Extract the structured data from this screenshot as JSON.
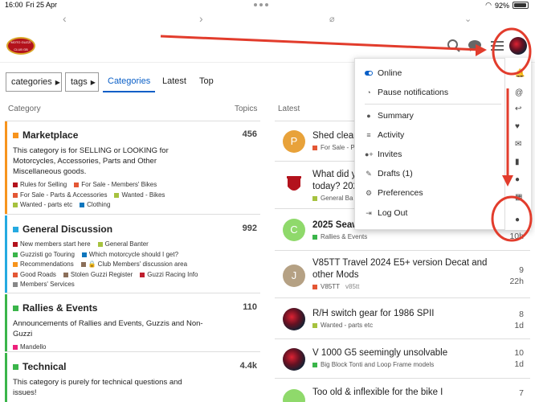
{
  "status_bar": {
    "time": "16:00",
    "date": "Fri 25 Apr",
    "battery": "92%"
  },
  "header": {
    "logo_text": "MOTO GUZZI CLUB GB"
  },
  "nav": {
    "categories_dropdown": "categories",
    "tags_dropdown": "tags",
    "tabs": [
      {
        "label": "Categories",
        "active": true
      },
      {
        "label": "Latest",
        "active": false
      },
      {
        "label": "Top",
        "active": false
      }
    ]
  },
  "columns": {
    "category": "Category",
    "topics": "Topics",
    "latest": "Latest"
  },
  "categories": [
    {
      "name": "Marketplace",
      "color": "#f7941d",
      "count": "456",
      "description": "This category is for SELLING or LOOKING for Motorcycles, Accessories, Parts and Other Miscellaneous goods.",
      "subcategories": [
        {
          "name": "Rules for Selling",
          "color": "#b3121c"
        },
        {
          "name": "For Sale - Members' Bikes",
          "color": "#e45735"
        },
        {
          "name": "For Sale - Parts & Accessories",
          "color": "#e45735"
        },
        {
          "name": "Wanted - Bikes",
          "color": "#a6c23f"
        },
        {
          "name": "Wanted - parts etc",
          "color": "#a6c23f"
        },
        {
          "name": "Clothing",
          "color": "#0e76bd"
        }
      ]
    },
    {
      "name": "General Discussion",
      "color": "#25aae1",
      "count": "992",
      "description": "",
      "subcategories": [
        {
          "name": "New members start here",
          "color": "#b3121c"
        },
        {
          "name": "General Banter",
          "color": "#a6c23f"
        },
        {
          "name": "Guzzisti go Touring",
          "color": "#3ab54a"
        },
        {
          "name": "Which motorcycle should I get?",
          "color": "#0e76bd"
        },
        {
          "name": "Recommendations",
          "color": "#f7941d"
        },
        {
          "name": "Club Members' discussion area",
          "color": "#8b6f5a"
        },
        {
          "name": "Good Roads",
          "color": "#e45735"
        },
        {
          "name": "Stolen Guzzi Register",
          "color": "#8b6f5a"
        },
        {
          "name": "Guzzi Racing Info",
          "color": "#bf1e2e"
        },
        {
          "name": "Members' Services",
          "color": "#888888"
        }
      ]
    },
    {
      "name": "Rallies & Events",
      "color": "#3ab54a",
      "count": "110",
      "description": "Announcements of Rallies and Events, Guzzis and Non-Guzzi",
      "subcategories": [
        {
          "name": "Mandello",
          "color": "#ed207b"
        }
      ]
    },
    {
      "name": "Technical",
      "color": "#3ab54a",
      "count": "4.4k",
      "description": "This category is purely for technical questions and issues!",
      "subcategories": []
    }
  ],
  "latest_topics": [
    {
      "avatar": "P",
      "avatar_color": "#e8a23a",
      "title": "Shed clear",
      "category": "For Sale - P",
      "category_color": "#e45735",
      "replies": "",
      "age": ""
    },
    {
      "avatar": "",
      "avatar_color": "#ffffff",
      "title": "What did y today? 202",
      "category": "General Ba",
      "category_color": "#a6c23f",
      "replies": "",
      "age": ""
    },
    {
      "avatar": "C",
      "avatar_color": "#8fd96b",
      "title": "2025 Seaw",
      "category": "Rallies & Events",
      "category_color": "#3ab54a",
      "replies": "",
      "age": "10h"
    },
    {
      "avatar": "J",
      "avatar_color": "#b5a184",
      "title": "V85TT Travel 2024 E5+ version Decat and other Mods",
      "category": "V85TT",
      "category_color": "#e45735",
      "tag": "v85tt",
      "replies": "9",
      "age": "22h"
    },
    {
      "avatar": "",
      "avatar_color": "#5a2a3a",
      "title": "R/H switch gear for 1986 SPII",
      "category": "Wanted - parts etc",
      "category_color": "#a6c23f",
      "replies": "8",
      "age": "1d"
    },
    {
      "avatar": "",
      "avatar_color": "#5a2a3a",
      "title": "V 1000 G5 seemingly unsolvable",
      "category": "Big Block Tonti and Loop Frame models",
      "category_color": "#3ab54a",
      "replies": "10",
      "age": "1d"
    },
    {
      "avatar": "",
      "avatar_color": "#8fd96b",
      "title": "Too old & inflexible for the bike I",
      "category": "",
      "category_color": "#3ab54a",
      "replies": "7",
      "age": ""
    }
  ],
  "user_menu": {
    "items": [
      {
        "label": "Online",
        "icon": "toggle-icon"
      },
      {
        "label": "Pause notifications",
        "icon": "pause-icon"
      },
      {
        "label": "Summary",
        "icon": "user-icon"
      },
      {
        "label": "Activity",
        "icon": "list-icon"
      },
      {
        "label": "Invites",
        "icon": "user-plus-icon"
      },
      {
        "label": "Drafts (1)",
        "icon": "pencil-icon"
      },
      {
        "label": "Preferences",
        "icon": "gear-icon"
      },
      {
        "label": "Log Out",
        "icon": "sign-out-icon"
      }
    ]
  },
  "annotation_color": "#e23c2c"
}
